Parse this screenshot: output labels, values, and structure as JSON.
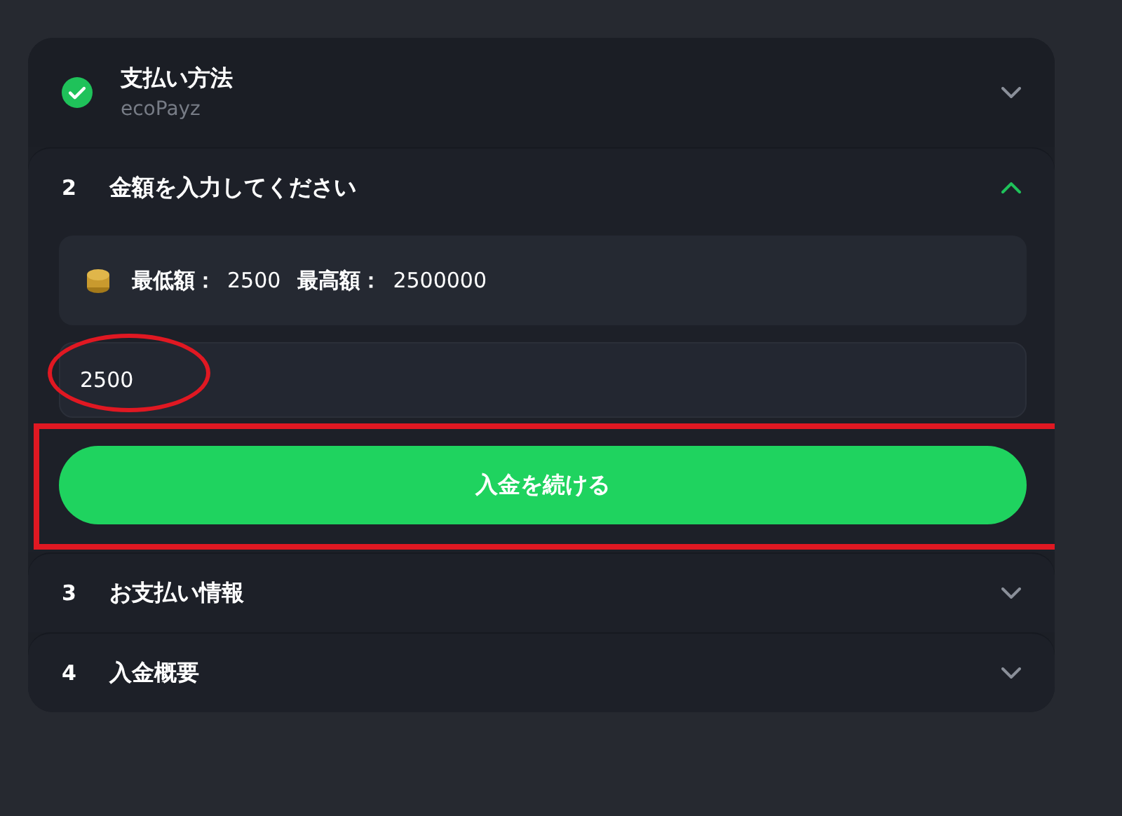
{
  "steps": [
    {
      "kind": "done",
      "title": "支払い方法",
      "subtitle": "ecoPayz",
      "expanded": false
    },
    {
      "kind": "number",
      "number": "2",
      "title": "金額を入力してください",
      "expanded": true,
      "limits": [
        {
          "label": "最低額：",
          "value": "2500"
        },
        {
          "label": "最高額：",
          "value": "2500000"
        }
      ],
      "amount": {
        "value": "2500"
      },
      "button": "入金を続ける"
    },
    {
      "kind": "number",
      "number": "3",
      "title": "お支払い情報",
      "expanded": false
    },
    {
      "kind": "number",
      "number": "4",
      "title": "入金概要",
      "expanded": false
    }
  ]
}
